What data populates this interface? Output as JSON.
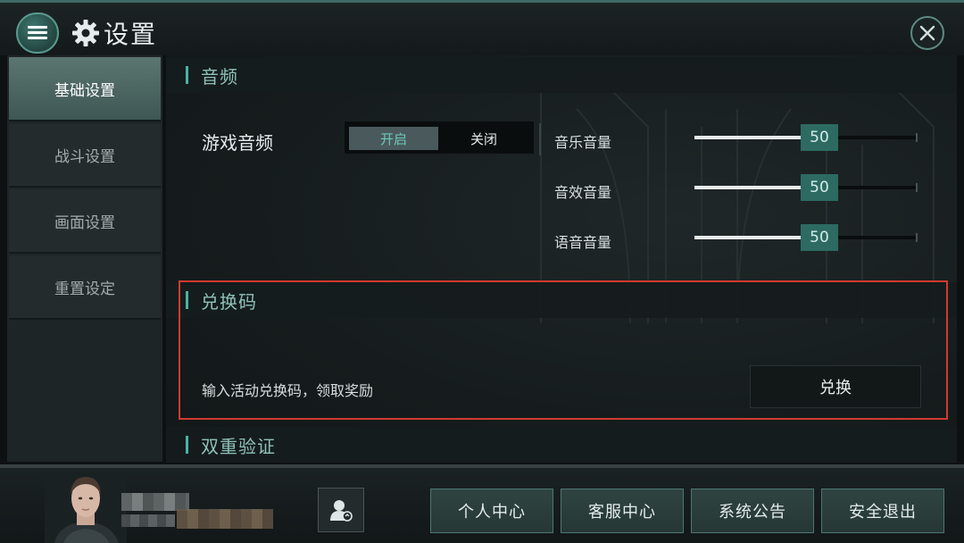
{
  "header": {
    "title": "设置"
  },
  "nav": {
    "items": [
      {
        "label": "基础设置",
        "active": true
      },
      {
        "label": "战斗设置",
        "active": false
      },
      {
        "label": "画面设置",
        "active": false
      },
      {
        "label": "重置设定",
        "active": false
      }
    ]
  },
  "audio": {
    "section_title": "音频",
    "game_audio_label": "游戏音频",
    "toggle": {
      "on_label": "开启",
      "off_label": "关闭",
      "selected": "开启"
    },
    "sliders": [
      {
        "label": "音乐音量",
        "value": "50",
        "fraction": 0.5
      },
      {
        "label": "音效音量",
        "value": "50",
        "fraction": 0.5
      },
      {
        "label": "语音音量",
        "value": "50",
        "fraction": 0.5
      }
    ]
  },
  "redeem": {
    "section_title": "兑换码",
    "hint": "输入活动兑换码，领取奖励",
    "button_label": "兑换"
  },
  "two_factor": {
    "section_title": "双重验证"
  },
  "footer": {
    "buttons": [
      "个人中心",
      "客服中心",
      "系统公告",
      "安全退出"
    ]
  },
  "colors": {
    "accent": "#4ab3a6",
    "slider_handle": "#2c6a62",
    "highlight_border": "#d13a2f"
  }
}
